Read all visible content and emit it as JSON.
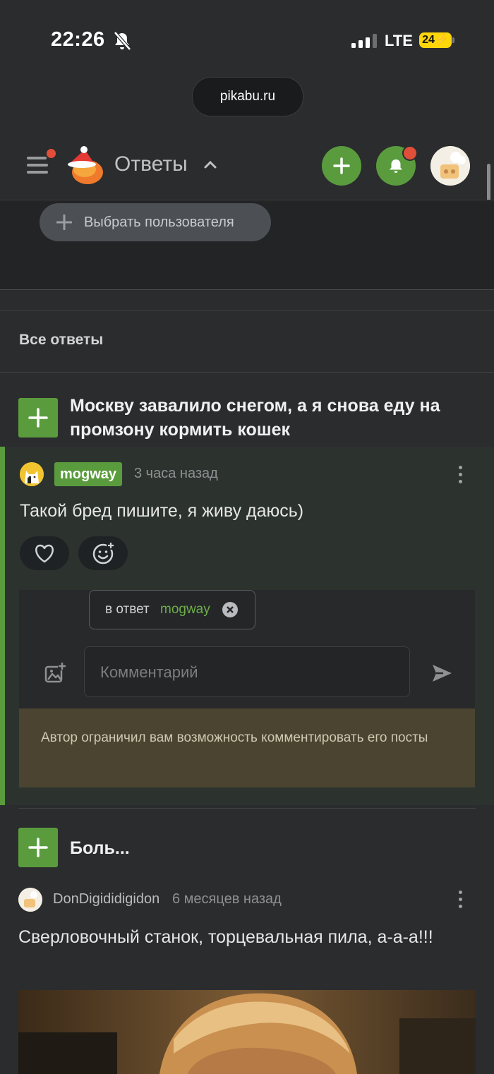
{
  "status_bar": {
    "time": "22:26",
    "network": "LTE",
    "battery": "24"
  },
  "browser": {
    "url": "pikabu.ru"
  },
  "header": {
    "title": "Ответы"
  },
  "filter": {
    "select_user_label": "Выбрать пользователя"
  },
  "section": {
    "title": "Все ответы"
  },
  "posts": [
    {
      "title": "Москву завалило снегом, а я снова еду на промзону кормить кошек",
      "comment": {
        "author": "mogway",
        "time": "3 часа назад",
        "text": "Такой бред пишите, я живу даюсь)"
      },
      "reply": {
        "prefix": "в ответ",
        "to": "mogway",
        "placeholder": "Комментарий",
        "restriction": "Автор ограничил вам возможность комментировать его посты"
      }
    },
    {
      "title": "Боль...",
      "comment": {
        "author": "DonDigididigidon",
        "time": "6 месяцев назад",
        "text": "Сверловочный станок, торцевальная пила, а-а-а!!!"
      }
    }
  ],
  "colors": {
    "accent_green": "#5a9c3d",
    "notif_red": "#e04f3a",
    "restriction_bg": "#4a4430"
  }
}
